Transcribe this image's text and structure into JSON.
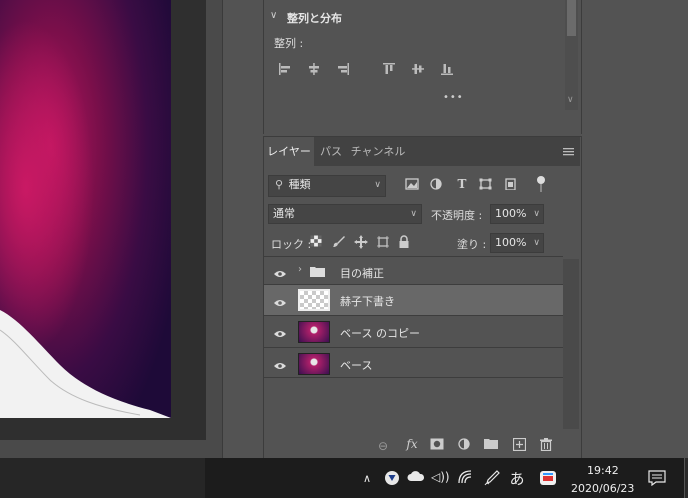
{
  "align_panel": {
    "title": "整列と分布",
    "align_label": "整列 :",
    "more": "•••"
  },
  "layers_panel": {
    "tabs": [
      {
        "label": "レイヤー",
        "active": true
      },
      {
        "label": "パス",
        "active": false
      },
      {
        "label": "チャンネル",
        "active": false
      }
    ],
    "filter_kind": "種類",
    "blend_mode": "通常",
    "opacity_label": "不透明度 :",
    "opacity_value": "100%",
    "lock_label": "ロック :",
    "fill_label": "塗り :",
    "fill_value": "100%",
    "layers": [
      {
        "name": "目の補正",
        "type": "group",
        "visible": true,
        "selected": false
      },
      {
        "name": "赫子下書き",
        "type": "transparent",
        "visible": true,
        "selected": true
      },
      {
        "name": "ベース のコピー",
        "type": "photo",
        "visible": true,
        "selected": false
      },
      {
        "name": "ベース",
        "type": "photo",
        "visible": true,
        "selected": false
      }
    ]
  },
  "taskbar": {
    "time": "19:42",
    "date": "2020/06/23",
    "ime": "あ"
  },
  "colors": {
    "panel_bg": "#535353",
    "selected_row": "#686868",
    "canvas_magenta": "#b0206a"
  }
}
